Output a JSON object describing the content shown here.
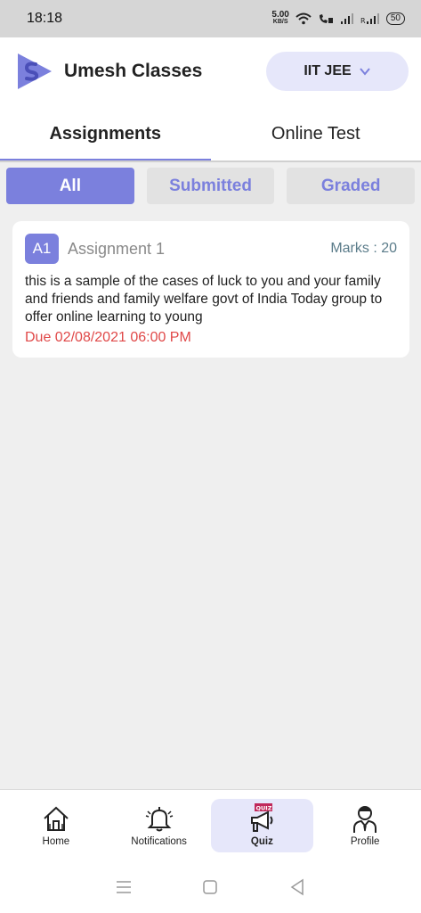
{
  "status_bar": {
    "time": "18:18",
    "speed_value": "5.00",
    "speed_unit": "KB/S",
    "battery": "50"
  },
  "header": {
    "app_title": "Umesh Classes",
    "course_selected": "IIT JEE",
    "accent_color": "#7b80dd"
  },
  "tabs": [
    {
      "label": "Assignments",
      "active": true
    },
    {
      "label": "Online Test",
      "active": false
    }
  ],
  "filters": [
    {
      "label": "All",
      "active": true
    },
    {
      "label": "Submitted",
      "active": false
    },
    {
      "label": "Graded",
      "active": false
    }
  ],
  "assignments": [
    {
      "badge": "A1",
      "title": "Assignment 1",
      "marks": "Marks : 20",
      "description": "this is a sample of the cases of luck to you and your family and friends and family welfare govt of India Today group to offer online learning to young",
      "due": "Due 02/08/2021 06:00 PM"
    }
  ],
  "bottom_nav": [
    {
      "label": "Home",
      "icon": "home-icon",
      "active": false
    },
    {
      "label": "Notifications",
      "icon": "bell-icon",
      "active": false
    },
    {
      "label": "Quiz",
      "icon": "quiz-megaphone-icon",
      "badge": "QUIZ",
      "active": true
    },
    {
      "label": "Profile",
      "icon": "profile-icon",
      "active": false
    }
  ],
  "system_nav": [
    "menu-icon",
    "home-square-icon",
    "back-triangle-icon"
  ]
}
